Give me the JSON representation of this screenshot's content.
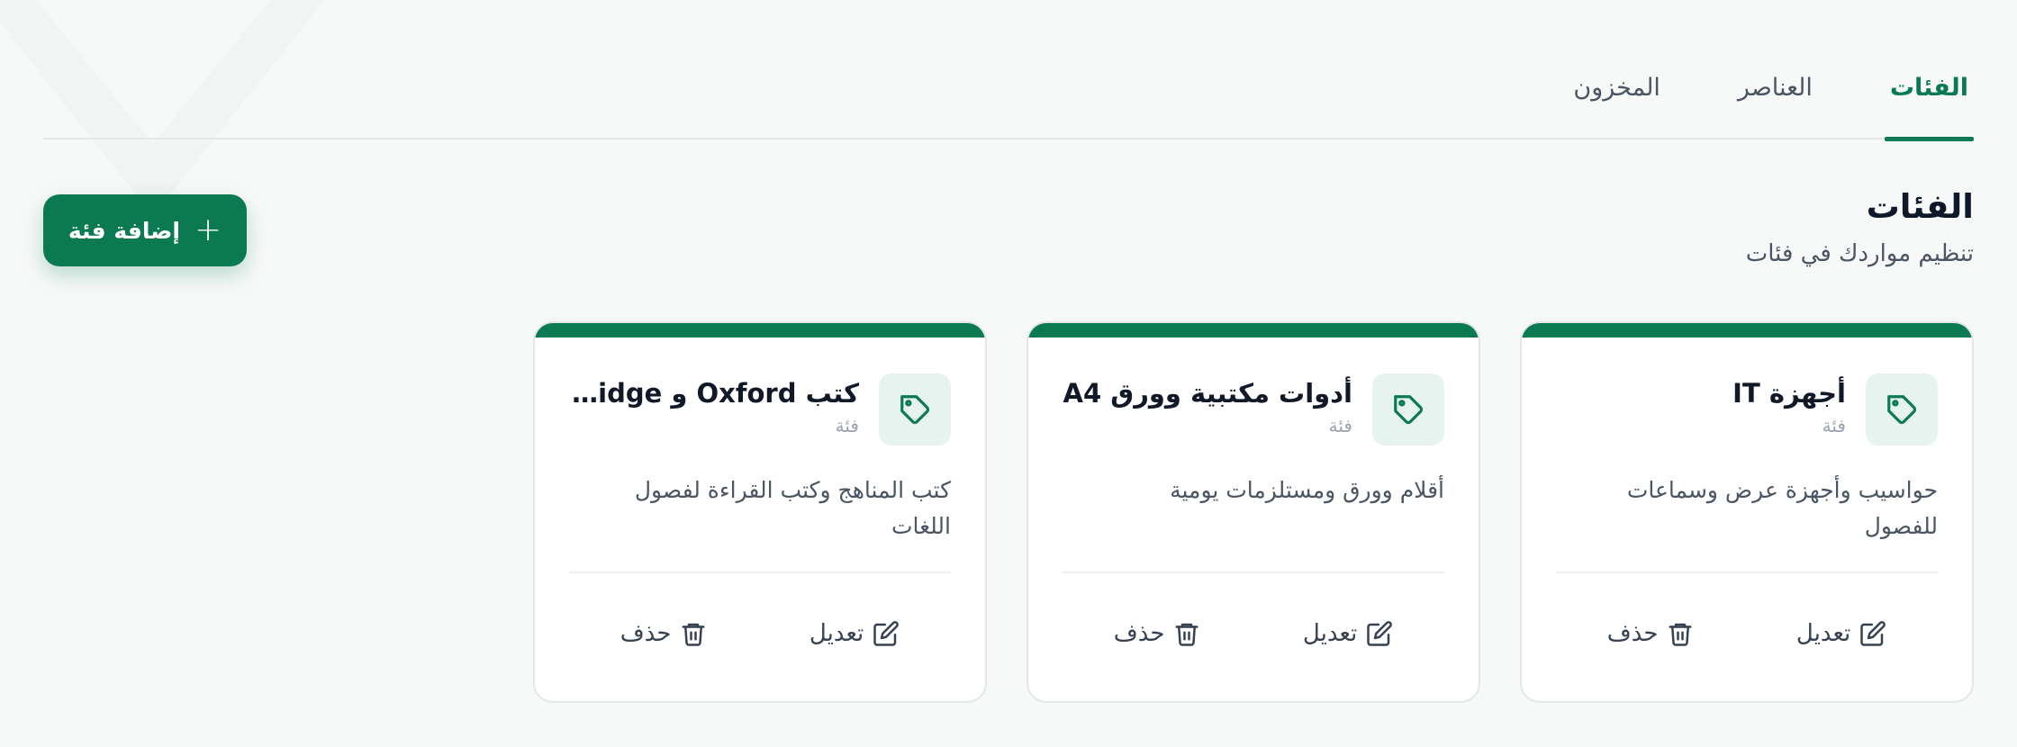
{
  "tabs": [
    {
      "label": "الفئات",
      "active": true
    },
    {
      "label": "العناصر",
      "active": false
    },
    {
      "label": "المخزون",
      "active": false
    }
  ],
  "header": {
    "title": "الفئات",
    "subtitle": "تنظيم مواردك في فئات"
  },
  "add_button": {
    "label": "إضافة فئة",
    "icon": "plus-icon"
  },
  "cards": [
    {
      "title": "أجهزة IT",
      "type": "فئة",
      "description": "حواسيب وأجهزة عرض وسماعات للفصول",
      "edit_label": "تعديل",
      "delete_label": "حذف"
    },
    {
      "title": "أدوات مكتبية وورق A4",
      "type": "فئة",
      "description": "أقلام وورق ومستلزمات يومية",
      "edit_label": "تعديل",
      "delete_label": "حذف"
    },
    {
      "title": "كتب Oxford و Cambridge",
      "type": "فئة",
      "description": "كتب المناهج وكتب القراءة لفصول اللغات",
      "edit_label": "تعديل",
      "delete_label": "حذف"
    }
  ],
  "colors": {
    "accent": "#0b7a52",
    "accent_light": "#e7f3ee",
    "text_muted": "#4b5563"
  }
}
